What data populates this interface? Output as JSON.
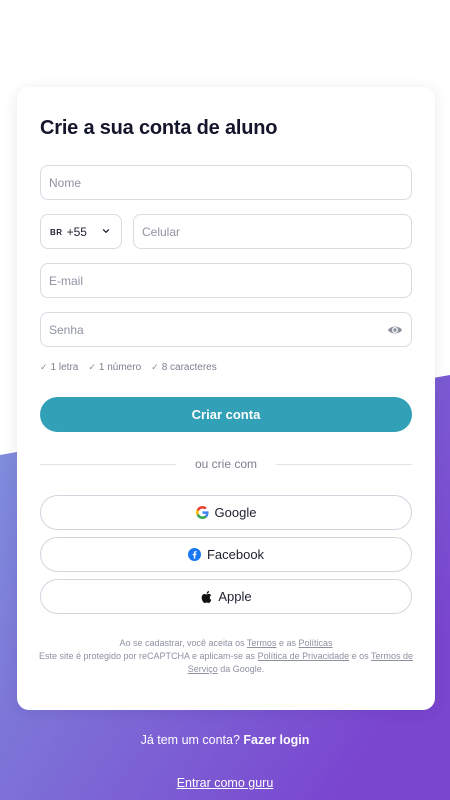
{
  "page": {
    "title": "Crie a sua conta de aluno"
  },
  "form": {
    "name_placeholder": "Nome",
    "country_code_badge": "BR",
    "country_code": "+55",
    "phone_placeholder": "Celular",
    "email_placeholder": "E-mail",
    "password_placeholder": "Senha",
    "hints": [
      "1 letra",
      "1 número",
      "8 caracteres"
    ],
    "submit_label": "Criar conta"
  },
  "divider_text": "ou crie com",
  "social": {
    "google": "Google",
    "facebook": "Facebook",
    "apple": "Apple"
  },
  "legal": {
    "line1_prefix": "Ao se cadastrar, você aceita os",
    "terms": "Termos",
    "and": "e as",
    "policies": "Políticas",
    "line2_prefix": "Este site é protegido por reCAPTCHA e aplicam-se as",
    "privacy_policy": "Política de Privacidade",
    "and_the": "e os",
    "terms_of_service": "Termos de Serviço",
    "from_google": "da Google."
  },
  "footer": {
    "have_account": "Já tem um conta?",
    "login_link": "Fazer login",
    "guru_link": "Entrar como guru"
  },
  "colors": {
    "accent": "#32a0b6",
    "gradient_start": "#7f8fdc",
    "gradient_end": "#7a47cf"
  }
}
